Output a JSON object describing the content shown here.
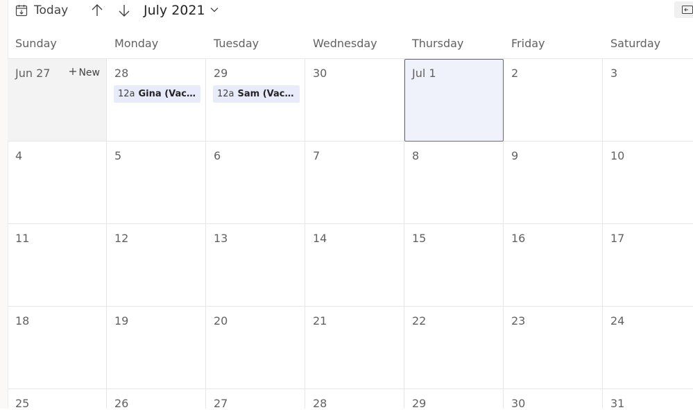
{
  "toolbar": {
    "today_label": "Today",
    "month_label": "July 2021",
    "icons": {
      "today": "calendar-today-icon",
      "prev": "arrow-up-icon",
      "next": "arrow-down-icon",
      "month_dropdown": "chevron-down-icon",
      "corner": "panel-collapse-icon"
    }
  },
  "weekdays": [
    "Sunday",
    "Monday",
    "Tuesday",
    "Wednesday",
    "Thursday",
    "Friday",
    "Saturday"
  ],
  "new_label": "New",
  "weeks": [
    [
      {
        "label": "Jun 27",
        "past": true,
        "new": true
      },
      {
        "label": "28",
        "event": {
          "time": "12a",
          "title": "Gina (Vacation)"
        }
      },
      {
        "label": "29",
        "event": {
          "time": "12a",
          "title": "Sam (Vacation)"
        }
      },
      {
        "label": "30"
      },
      {
        "label": "Jul 1",
        "selected": true
      },
      {
        "label": "2"
      },
      {
        "label": "3"
      }
    ],
    [
      {
        "label": "4"
      },
      {
        "label": "5"
      },
      {
        "label": "6"
      },
      {
        "label": "7"
      },
      {
        "label": "8"
      },
      {
        "label": "9"
      },
      {
        "label": "10"
      }
    ],
    [
      {
        "label": "11"
      },
      {
        "label": "12"
      },
      {
        "label": "13"
      },
      {
        "label": "14"
      },
      {
        "label": "15"
      },
      {
        "label": "16"
      },
      {
        "label": "17"
      }
    ],
    [
      {
        "label": "18"
      },
      {
        "label": "19"
      },
      {
        "label": "20"
      },
      {
        "label": "21"
      },
      {
        "label": "22"
      },
      {
        "label": "23"
      },
      {
        "label": "24"
      }
    ],
    [
      {
        "label": "25"
      },
      {
        "label": "26"
      },
      {
        "label": "27"
      },
      {
        "label": "28"
      },
      {
        "label": "29"
      },
      {
        "label": "30"
      },
      {
        "label": "31"
      }
    ]
  ],
  "colors": {
    "accent": "#5b5fc7",
    "event_bg": "#e8ebfa",
    "selected_bg": "#eff1fb",
    "past_bg": "#f3f3f3"
  }
}
